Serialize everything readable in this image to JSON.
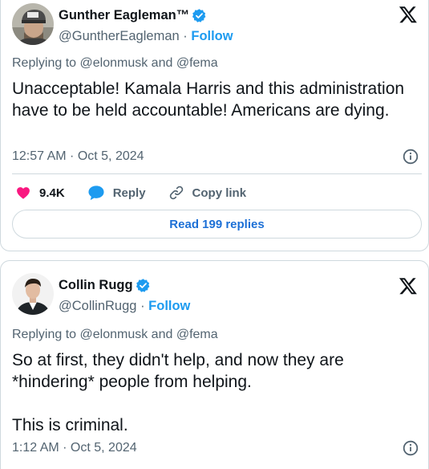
{
  "tweets": [
    {
      "author_name": "Gunther Eagleman™",
      "handle": "@GuntherEagleman",
      "follow_label": "Follow",
      "separator": "·",
      "replying_prefix": "Replying to",
      "mention_1": "@elonmusk",
      "and_word": "and",
      "mention_2": "@fema",
      "text": "Unacceptable!  Kamala Harris and this administration have to be held accountable! Americans are dying.",
      "timestamp": "12:57 AM · Oct 5, 2024",
      "likes": "9.4K",
      "reply_label": "Reply",
      "copy_link_label": "Copy link",
      "read_replies_label": "Read 199 replies"
    },
    {
      "author_name": "Collin Rugg",
      "handle": "@CollinRugg",
      "follow_label": "Follow",
      "separator": "·",
      "replying_prefix": "Replying to",
      "mention_1": "@elonmusk",
      "and_word": "and",
      "mention_2": "@fema",
      "text": "So at first, they didn't help, and now they are *hindering* people from helping.\n\nThis is criminal.",
      "timestamp": "1:12 AM · Oct 5, 2024"
    }
  ],
  "icons": {
    "verified": "verified-badge-icon",
    "platform_logo": "x-logo-icon",
    "info": "info-icon",
    "like": "heart-icon",
    "reply": "speech-bubble-icon",
    "copy_link": "link-icon"
  },
  "colors": {
    "accent_blue": "#1d9bf0",
    "like_red": "#f91880",
    "muted_text": "#536471",
    "border": "#cfd9de"
  }
}
